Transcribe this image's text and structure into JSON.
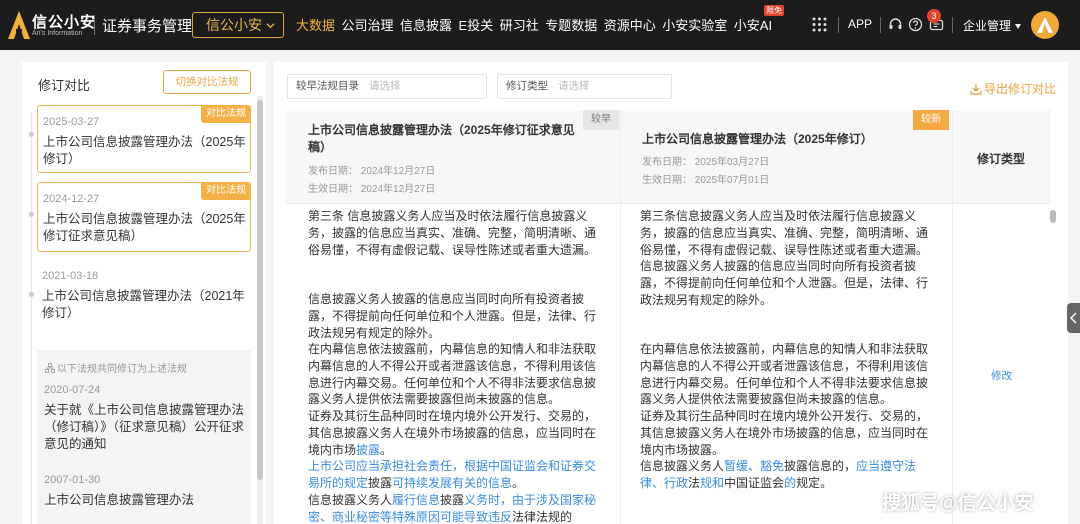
{
  "header": {
    "logo_text": "信公小安",
    "logo_sub": "An's Information",
    "system_title": "证券事务管理",
    "brand_selector": "信公小安",
    "nav": [
      {
        "label": "大数据",
        "active": true
      },
      {
        "label": "公司治理"
      },
      {
        "label": "信息披露"
      },
      {
        "label": "E投关"
      },
      {
        "label": "研习社"
      },
      {
        "label": "专题数据"
      },
      {
        "label": "资源中心"
      },
      {
        "label": "小安实验室"
      },
      {
        "label": "小安AI",
        "badge": "限免"
      }
    ],
    "app_label": "APP",
    "message_count": "3",
    "enterprise_label": "企业管理",
    "accent_color": "#f0b23c"
  },
  "left": {
    "title": "修订对比",
    "switch_button": "切换对比法规",
    "compare_tag": "对比法规",
    "revisions": [
      {
        "date": "2025-03-27",
        "title": "上市公司信息披露管理办法（2025年修订）",
        "selected": true
      },
      {
        "date": "2024-12-27",
        "title": "上市公司信息披露管理办法（2025年修订征求意见稿）",
        "selected": true
      },
      {
        "date": "2021-03-18",
        "title": "上市公司信息披露管理办法（2021年修订）",
        "selected": false
      }
    ],
    "same_note": "以下法规共同修订为上述法规",
    "same_revisions": [
      {
        "date": "2020-07-24",
        "title": "关于就《上市公司信息披露管理办法（修订稿）》（征求意见稿）公开征求意见的通知"
      },
      {
        "date": "2007-01-30",
        "title": "上市公司信息披露管理办法"
      }
    ]
  },
  "filters": {
    "earlier_label": "较早法规目录",
    "earlier_placeholder": "请选择",
    "type_label": "修订类型",
    "type_placeholder": "请选择",
    "export": "导出修订对比"
  },
  "table": {
    "earlier": {
      "tag": "较早",
      "title": "上市公司信息披露管理办法（2025年修订征求意见稿）",
      "publish": "发布日期：  2024年12月27日",
      "effective": "生效日期：  2024年12月27日"
    },
    "later": {
      "tag": "较新",
      "title": "上市公司信息披露管理办法（2025年修订）",
      "publish": "发布日期：  2025年03月27日",
      "effective": "生效日期：  2025年07月01日"
    },
    "type_header": "修订类型",
    "modify_link": "修改",
    "earlier_body": {
      "p1": "第三条 信息披露义务人应当及时依法履行信息披露义务，披露的信息应当真实、准确、完整，简明清晰、通俗易懂，不得有虚假记载、误导性陈述或者重大遗漏。",
      "p2": "信息披露义务人披露的信息应当同时向所有投资者披露，不得提前向任何单位和个人泄露。但是，法律、行政法规另有规定的除外。",
      "p3": "在内幕信息依法披露前，内幕信息的知情人和非法获取内幕信息的人不得公开或者泄露该信息，不得利用该信息进行内幕交易。任何单位和个人不得非法要求信息披露义务人提供依法需要披露但尚未披露的信息。",
      "p4a": "证券及其衍生品种同时在境内境外公开发行、交易的，其信息披露义务人在境外市场披露的信息，应当同时在境内市场",
      "p4b": "披露",
      "p4c": "。",
      "p5a": "上市公司应当承担社会责任，根据中国证监会和证券交易所的规定",
      "p5b": "披露",
      "p5c": "可持续发展有关的信息",
      "p5d": "。",
      "p6a": "信息披露义务人",
      "p6b": "履行信息",
      "p6c": "披露",
      "p6d": "义务时，由于涉及国家秘",
      "p6e": "密、商业秘密等特殊原因可能导致违反",
      "p6f": "法律法规的"
    },
    "later_body": {
      "p1": "第三条信息披露义务人应当及时依法履行信息披露义务，披露的信息应当真实、准确、完整，简明清晰、通俗易懂，不得有虚假记载、误导性陈述或者重大遗漏。",
      "p2": "信息披露义务人披露的信息应当同时向所有投资者披露，不得提前向任何单位和个人泄露。但是，法律、行政法规另有规定的除外。",
      "p3": "在内幕信息依法披露前，内幕信息的知情人和非法获取内幕信息的人不得公开或者泄露该信息，不得利用该信息进行内幕交易。任何单位和个人不得非法要求信息披露义务人提供依法需要披露但尚未披露的信息。",
      "p4": "证券及其衍生品种同时在境内境外公开发行、交易的，其信息披露义务人在境外市场披露的信息，应当同时在境内市场披露。",
      "p5a": "信息披露义务人",
      "p5b": "暂缓、豁免",
      "p5c": "披露信息的，",
      "p5d": "应当遵守法律、行政",
      "p5e": "法",
      "p5f": "规和",
      "p5g": "中国证监会",
      "p5h": "的",
      "p5i": "规定。"
    }
  },
  "watermark": "搜狐号@信公小安"
}
